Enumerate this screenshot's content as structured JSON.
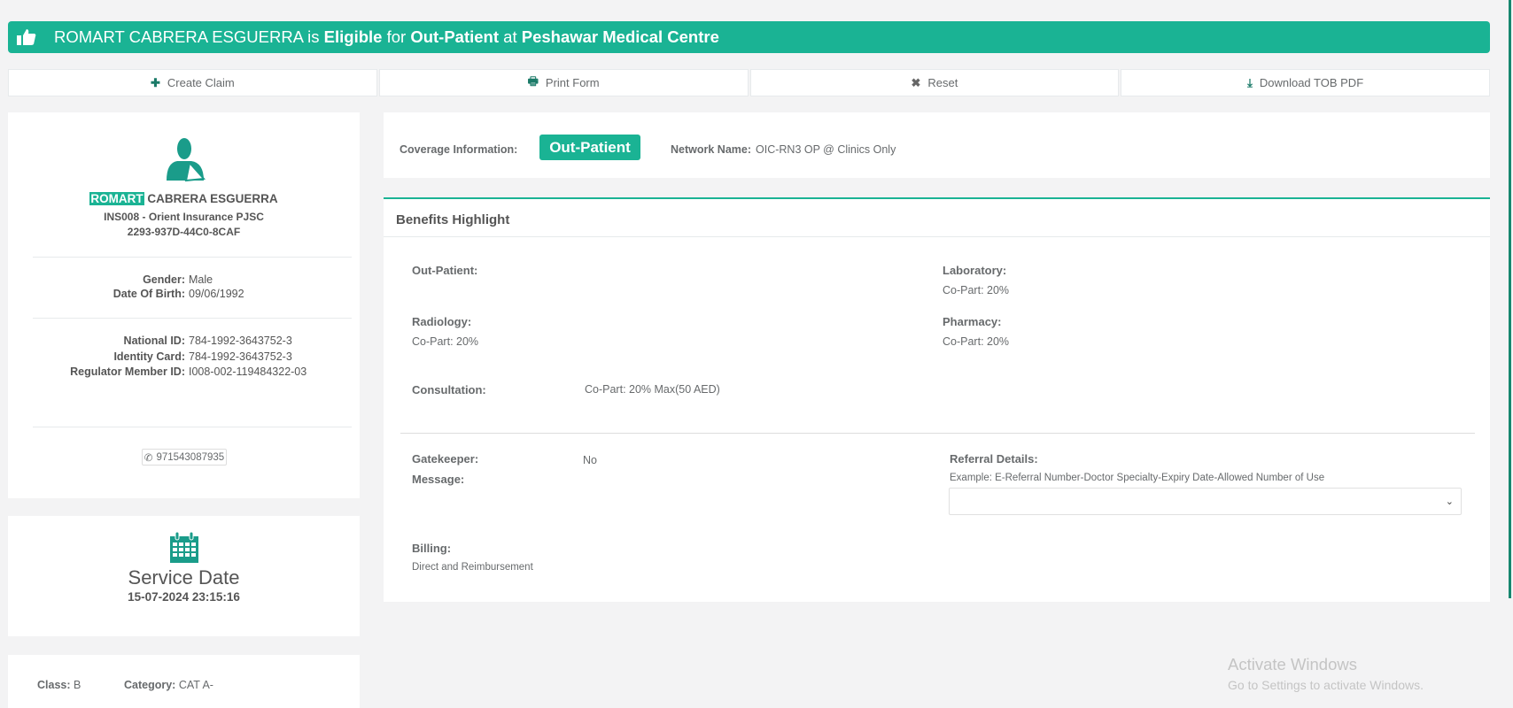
{
  "banner": {
    "icon": "thumbs-up-icon",
    "member": "ROMART CABRERA ESGUERRA",
    "is": "is",
    "status": "Eligible",
    "for": "for",
    "coverage": "Out-Patient",
    "at": "at",
    "provider": "Peshawar Medical Centre"
  },
  "toolbar": [
    {
      "label": "Create Claim",
      "icon": "plus-icon"
    },
    {
      "label": "Print Form",
      "icon": "print-icon"
    },
    {
      "label": "Reset",
      "icon": "close-icon"
    },
    {
      "label": "Download TOB PDF",
      "icon": "download-icon"
    }
  ],
  "member": {
    "first_name": "ROMART",
    "rest_name": "CABRERA ESGUERRA",
    "insurer": "INS008 - Orient Insurance PJSC",
    "card_id": "2293-937D-44C0-8CAF",
    "gender_label": "Gender:",
    "gender": "Male",
    "dob_label": "Date Of Birth:",
    "dob": "09/06/1992",
    "national_label": "National ID:",
    "national": "784-1992-3643752-3",
    "identity_label": "Identity Card:",
    "identity": "784-1992-3643752-3",
    "regulator_label": "Regulator Member ID:",
    "regulator": "I008-002-119484322-03",
    "phone": "971543087935"
  },
  "service": {
    "title": "Service Date",
    "date": "15-07-2024 23:15:16"
  },
  "class_card": {
    "class_label": "Class:",
    "class": "B",
    "category_label": "Category:",
    "category": "CAT A-"
  },
  "coverage": {
    "label": "Coverage Information:",
    "badge": "Out-Patient",
    "network_label": "Network Name:",
    "network": "OIC-RN3 OP @ Clinics Only"
  },
  "benefits": {
    "title": "Benefits Highlight",
    "outpatient_label": "Out-Patient:",
    "laboratory_label": "Laboratory:",
    "laboratory": "Co-Part: 20%",
    "radiology_label": "Radiology:",
    "radiology": "Co-Part: 20%",
    "pharmacy_label": "Pharmacy:",
    "pharmacy": "Co-Part: 20%",
    "consultation_label": "Consultation:",
    "consultation": "Co-Part: 20% Max(50 AED)",
    "gatekeeper_label": "Gatekeeper:",
    "gatekeeper": "No",
    "message_label": "Message:",
    "referral_label": "Referral Details:",
    "referral_hint": "Example: E-Referral Number-Doctor Specialty-Expiry Date-Allowed Number of Use",
    "referral_value": "",
    "billing_label": "Billing:",
    "billing": "Direct and Reimbursement"
  },
  "watermark": {
    "line1": "Activate Windows",
    "line2": "Go to Settings to activate Windows."
  }
}
